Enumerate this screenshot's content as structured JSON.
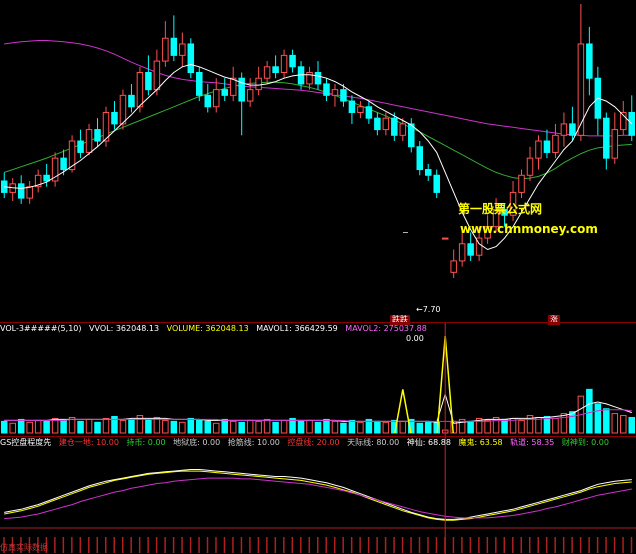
{
  "colors": {
    "up": "#ff5050",
    "down": "#00ffff",
    "ma_white": "#ffffff",
    "ma_magenta": "#cc33cc",
    "ma_green": "#33aa33",
    "text_red": "#ff3333",
    "text_green": "#33cc33",
    "text_yellow": "#ffff00",
    "text_cyan": "#00cccc",
    "text_magenta": "#ff66ff",
    "text_white": "#ffffff",
    "separator": "#8b0000"
  },
  "watermark": {
    "cn": "第一股票公式网",
    "en": "www.chnmoney.com"
  },
  "markers": {
    "low_price": "←7.70",
    "dash": "−",
    "badge_a": "跌跌",
    "badge_b": "涨"
  },
  "vol_header": {
    "name": "VOL-3#####(5,10)",
    "vvol": "VVOL: 362048.13",
    "volume": "VOLUME: 362048.13",
    "mavol1": "MAVOL1: 366429.59",
    "mavol2": "MAVOL2: 275037.88",
    "value": "0.00"
  },
  "ind_header": {
    "name": "GS控盘程度先",
    "i1": "建仓一地: 10.00",
    "i2": "持币: 0.00",
    "i3": "地狱底: 0.00",
    "i4": "抢筋线: 10.00",
    "i5": "控盘线: 20.00",
    "i6": "天际线: 80.00",
    "i7": "神仙: 68.88",
    "i8": "魔鬼: 63.58",
    "i9": "轨道: 58.35",
    "i10": "财神到: 0.00"
  },
  "footer_label": "仿真实际数据",
  "chart_data": [
    {
      "type": "candlestick",
      "title": "",
      "ylim": [
        7.0,
        12.5
      ],
      "low_label": 7.7,
      "candles": [
        [
          9.4,
          9.2,
          9.55,
          9.1
        ],
        [
          9.2,
          9.35,
          9.45,
          9.05
        ],
        [
          9.35,
          9.1,
          9.5,
          9.0
        ],
        [
          9.1,
          9.3,
          9.4,
          9.0
        ],
        [
          9.3,
          9.5,
          9.6,
          9.2
        ],
        [
          9.5,
          9.4,
          9.7,
          9.3
        ],
        [
          9.4,
          9.8,
          9.9,
          9.3
        ],
        [
          9.8,
          9.6,
          9.95,
          9.5
        ],
        [
          9.6,
          10.1,
          10.2,
          9.55
        ],
        [
          10.1,
          9.9,
          10.3,
          9.8
        ],
        [
          9.9,
          10.3,
          10.4,
          9.85
        ],
        [
          10.3,
          10.1,
          10.5,
          10.0
        ],
        [
          10.1,
          10.6,
          10.7,
          10.0
        ],
        [
          10.6,
          10.4,
          10.8,
          10.3
        ],
        [
          10.4,
          10.9,
          11.0,
          10.3
        ],
        [
          10.9,
          10.7,
          11.1,
          10.6
        ],
        [
          10.7,
          11.3,
          11.4,
          10.6
        ],
        [
          11.3,
          11.0,
          11.6,
          10.9
        ],
        [
          11.0,
          11.5,
          11.7,
          10.9
        ],
        [
          11.5,
          11.9,
          12.2,
          11.4
        ],
        [
          11.9,
          11.6,
          12.3,
          11.5
        ],
        [
          11.6,
          11.8,
          12.0,
          11.4
        ],
        [
          11.8,
          11.3,
          11.9,
          11.2
        ],
        [
          11.3,
          10.9,
          11.4,
          10.8
        ],
        [
          10.9,
          10.7,
          11.1,
          10.6
        ],
        [
          10.7,
          11.0,
          11.2,
          10.6
        ],
        [
          11.0,
          10.9,
          11.2,
          10.8
        ],
        [
          10.9,
          11.2,
          11.4,
          10.8
        ],
        [
          11.2,
          10.8,
          11.3,
          10.2
        ],
        [
          10.8,
          11.0,
          11.2,
          10.7
        ],
        [
          11.0,
          11.2,
          11.4,
          10.9
        ],
        [
          11.2,
          11.4,
          11.5,
          11.1
        ],
        [
          11.4,
          11.3,
          11.6,
          11.2
        ],
        [
          11.3,
          11.6,
          11.7,
          11.2
        ],
        [
          11.6,
          11.4,
          11.7,
          11.3
        ],
        [
          11.4,
          11.1,
          11.5,
          11.0
        ],
        [
          11.1,
          11.3,
          11.4,
          11.0
        ],
        [
          11.3,
          11.1,
          11.5,
          11.0
        ],
        [
          11.1,
          10.9,
          11.2,
          10.8
        ],
        [
          10.9,
          11.0,
          11.1,
          10.7
        ],
        [
          11.0,
          10.8,
          11.1,
          10.7
        ],
        [
          10.8,
          10.6,
          10.9,
          10.4
        ],
        [
          10.6,
          10.7,
          10.8,
          10.5
        ],
        [
          10.7,
          10.5,
          10.8,
          10.4
        ],
        [
          10.5,
          10.3,
          10.6,
          10.2
        ],
        [
          10.3,
          10.5,
          10.6,
          10.2
        ],
        [
          10.5,
          10.2,
          10.6,
          10.1
        ],
        [
          10.2,
          10.4,
          10.5,
          10.1
        ],
        [
          10.4,
          10.0,
          10.5,
          9.9
        ],
        [
          10.0,
          9.6,
          10.1,
          9.5
        ],
        [
          9.6,
          9.5,
          9.7,
          9.4
        ],
        [
          9.5,
          9.2,
          9.6,
          9.1
        ],
        [
          8.4,
          8.4,
          8.4,
          8.4
        ],
        [
          7.8,
          8.0,
          8.2,
          7.7
        ],
        [
          8.0,
          8.3,
          8.6,
          7.9
        ],
        [
          8.3,
          8.1,
          8.5,
          8.0
        ],
        [
          8.1,
          8.4,
          8.6,
          8.0
        ],
        [
          8.4,
          8.6,
          8.8,
          8.3
        ],
        [
          8.6,
          8.9,
          9.1,
          8.5
        ],
        [
          8.9,
          8.8,
          9.0,
          8.6
        ],
        [
          8.8,
          9.2,
          9.4,
          8.7
        ],
        [
          9.2,
          9.5,
          9.6,
          9.1
        ],
        [
          9.5,
          9.8,
          10.0,
          9.4
        ],
        [
          9.8,
          10.1,
          10.2,
          9.6
        ],
        [
          10.1,
          9.9,
          10.3,
          9.8
        ],
        [
          9.9,
          10.2,
          10.4,
          9.8
        ],
        [
          10.2,
          10.4,
          10.6,
          10.0
        ],
        [
          10.4,
          10.2,
          10.7,
          10.1
        ],
        [
          10.2,
          11.8,
          12.5,
          10.1
        ],
        [
          11.8,
          11.2,
          12.1,
          10.9
        ],
        [
          11.2,
          10.5,
          11.4,
          10.2
        ],
        [
          10.5,
          9.8,
          10.6,
          9.6
        ],
        [
          9.8,
          10.3,
          10.6,
          9.7
        ],
        [
          10.3,
          10.6,
          10.8,
          10.2
        ],
        [
          10.6,
          10.2,
          10.9,
          10.1
        ]
      ],
      "ma_white": [
        9.3,
        9.28,
        9.27,
        9.29,
        9.33,
        9.38,
        9.47,
        9.56,
        9.66,
        9.76,
        9.88,
        10.0,
        10.14,
        10.28,
        10.42,
        10.56,
        10.72,
        10.86,
        11.0,
        11.16,
        11.3,
        11.4,
        11.44,
        11.4,
        11.34,
        11.28,
        11.22,
        11.18,
        11.12,
        11.08,
        11.08,
        11.1,
        11.14,
        11.2,
        11.24,
        11.26,
        11.26,
        11.24,
        11.2,
        11.14,
        11.06,
        10.96,
        10.88,
        10.8,
        10.7,
        10.62,
        10.54,
        10.46,
        10.38,
        10.26,
        10.1,
        9.9,
        9.55,
        9.2,
        8.85,
        8.55,
        8.3,
        8.2,
        8.25,
        8.4,
        8.6,
        8.85,
        9.1,
        9.35,
        9.55,
        9.75,
        9.95,
        10.1,
        10.4,
        10.7,
        10.85,
        10.8,
        10.7,
        10.55,
        10.4
      ],
      "ma_magenta": [
        11.8,
        11.82,
        11.84,
        11.85,
        11.86,
        11.86,
        11.85,
        11.84,
        11.82,
        11.8,
        11.77,
        11.73,
        11.68,
        11.62,
        11.55,
        11.48,
        11.42,
        11.36,
        11.3,
        11.25,
        11.21,
        11.18,
        11.16,
        11.14,
        11.13,
        11.12,
        11.1,
        11.08,
        11.06,
        11.05,
        11.04,
        11.03,
        11.02,
        11.01,
        11.0,
        10.99,
        10.97,
        10.95,
        10.93,
        10.91,
        10.89,
        10.87,
        10.85,
        10.82,
        10.79,
        10.76,
        10.73,
        10.7,
        10.67,
        10.64,
        10.61,
        10.58,
        10.55,
        10.52,
        10.49,
        10.46,
        10.43,
        10.4,
        10.38,
        10.36,
        10.34,
        10.32,
        10.3,
        10.28,
        10.26,
        10.24,
        10.22,
        10.21,
        10.2,
        10.19,
        10.19,
        10.19,
        10.19,
        10.2,
        10.2
      ],
      "ma_green": [
        9.55,
        9.6,
        9.65,
        9.7,
        9.75,
        9.8,
        9.86,
        9.92,
        9.98,
        10.04,
        10.1,
        10.16,
        10.22,
        10.28,
        10.34,
        10.4,
        10.46,
        10.52,
        10.58,
        10.64,
        10.7,
        10.76,
        10.82,
        10.88,
        10.93,
        10.98,
        11.02,
        11.06,
        11.09,
        11.11,
        11.12,
        11.13,
        11.13,
        11.12,
        11.1,
        11.07,
        11.04,
        11.0,
        10.95,
        10.9,
        10.84,
        10.78,
        10.72,
        10.66,
        10.6,
        10.54,
        10.47,
        10.4,
        10.33,
        10.26,
        10.18,
        10.1,
        10.02,
        9.94,
        9.86,
        9.78,
        9.7,
        9.62,
        9.55,
        9.5,
        9.46,
        9.44,
        9.45,
        9.48,
        9.54,
        9.62,
        9.72,
        9.8,
        9.88,
        9.94,
        9.98,
        10.0,
        10.02,
        10.03,
        10.04
      ]
    },
    {
      "type": "bar",
      "title": "VOL-3#####(5,10)",
      "ylim": [
        0,
        1
      ],
      "values": [
        0.12,
        0.1,
        0.14,
        0.11,
        0.13,
        0.12,
        0.15,
        0.13,
        0.16,
        0.12,
        0.14,
        0.11,
        0.15,
        0.17,
        0.13,
        0.14,
        0.18,
        0.14,
        0.16,
        0.13,
        0.12,
        0.11,
        0.15,
        0.13,
        0.12,
        0.1,
        0.14,
        0.12,
        0.11,
        0.13,
        0.12,
        0.14,
        0.11,
        0.13,
        0.15,
        0.12,
        0.13,
        0.11,
        0.14,
        0.12,
        0.1,
        0.13,
        0.11,
        0.14,
        0.12,
        0.11,
        0.13,
        0.12,
        0.14,
        0.1,
        0.12,
        0.11,
        0.03,
        0.12,
        0.14,
        0.12,
        0.15,
        0.13,
        0.16,
        0.14,
        0.15,
        0.13,
        0.18,
        0.16,
        0.17,
        0.15,
        0.2,
        0.22,
        0.38,
        0.45,
        0.3,
        0.25,
        0.2,
        0.18,
        0.16
      ],
      "mavol1": [
        0.13,
        0.13,
        0.13,
        0.13,
        0.13,
        0.13,
        0.14,
        0.14,
        0.14,
        0.14,
        0.14,
        0.14,
        0.14,
        0.14,
        0.14,
        0.15,
        0.15,
        0.15,
        0.15,
        0.15,
        0.14,
        0.14,
        0.14,
        0.14,
        0.13,
        0.13,
        0.13,
        0.13,
        0.13,
        0.13,
        0.13,
        0.13,
        0.13,
        0.13,
        0.13,
        0.13,
        0.13,
        0.13,
        0.13,
        0.13,
        0.12,
        0.12,
        0.12,
        0.12,
        0.12,
        0.12,
        0.12,
        0.12,
        0.12,
        0.12,
        0.12,
        0.11,
        0.4,
        0.1,
        0.11,
        0.12,
        0.13,
        0.14,
        0.14,
        0.14,
        0.15,
        0.15,
        0.15,
        0.16,
        0.16,
        0.17,
        0.18,
        0.2,
        0.25,
        0.3,
        0.32,
        0.3,
        0.27,
        0.24,
        0.21
      ],
      "mavol2": [
        0.13,
        0.13,
        0.13,
        0.13,
        0.13,
        0.13,
        0.13,
        0.13,
        0.14,
        0.14,
        0.14,
        0.14,
        0.14,
        0.14,
        0.14,
        0.14,
        0.14,
        0.14,
        0.14,
        0.14,
        0.14,
        0.14,
        0.14,
        0.14,
        0.14,
        0.14,
        0.13,
        0.13,
        0.13,
        0.13,
        0.13,
        0.13,
        0.13,
        0.13,
        0.13,
        0.13,
        0.13,
        0.13,
        0.13,
        0.13,
        0.13,
        0.12,
        0.12,
        0.12,
        0.12,
        0.12,
        0.12,
        0.12,
        0.12,
        0.12,
        0.12,
        0.12,
        0.12,
        0.12,
        0.12,
        0.12,
        0.12,
        0.12,
        0.13,
        0.13,
        0.13,
        0.14,
        0.14,
        0.14,
        0.15,
        0.15,
        0.16,
        0.17,
        0.19,
        0.21,
        0.23,
        0.24,
        0.24,
        0.24,
        0.23
      ],
      "spike_yellow": [
        [
          47,
          0.45
        ],
        [
          52,
          1.0
        ]
      ]
    },
    {
      "type": "line",
      "title": "GS控盘程度先",
      "ylim": [
        0,
        100
      ],
      "series": [
        {
          "name": "神仙",
          "values": [
            20,
            22,
            24,
            27,
            30,
            34,
            38,
            42,
            46,
            50,
            54,
            57,
            60,
            62,
            64,
            66,
            68,
            70,
            71,
            72,
            73,
            74,
            75,
            75,
            74,
            73,
            72,
            71,
            70,
            69,
            68,
            67,
            66,
            66,
            65,
            64,
            62,
            60,
            58,
            55,
            52,
            48,
            44,
            40,
            36,
            32,
            28,
            24,
            20,
            17,
            14,
            12,
            11,
            11,
            12,
            14,
            16,
            18,
            20,
            22,
            24,
            27,
            30,
            33,
            36,
            39,
            42,
            45,
            48,
            52,
            56,
            58,
            60,
            61,
            62
          ]
        },
        {
          "name": "魔鬼",
          "values": [
            18,
            20,
            22,
            25,
            28,
            32,
            36,
            40,
            44,
            48,
            52,
            55,
            58,
            61,
            63,
            65,
            67,
            69,
            70,
            71,
            72,
            73,
            73,
            73,
            72,
            71,
            70,
            69,
            68,
            67,
            66,
            65,
            64,
            63,
            62,
            61,
            59,
            57,
            55,
            52,
            49,
            46,
            42,
            38,
            34,
            30,
            26,
            22,
            19,
            16,
            13,
            11,
            10,
            10,
            11,
            12,
            14,
            16,
            18,
            20,
            22,
            25,
            28,
            31,
            34,
            37,
            40,
            43,
            46,
            50,
            53,
            55,
            57,
            58,
            59
          ]
        },
        {
          "name": "轨道",
          "values": [
            12,
            13,
            14,
            16,
            18,
            21,
            24,
            27,
            30,
            34,
            37,
            40,
            43,
            46,
            48,
            51,
            53,
            55,
            57,
            58,
            60,
            61,
            62,
            63,
            64,
            64,
            64,
            64,
            63,
            63,
            62,
            61,
            60,
            59,
            58,
            57,
            56,
            54,
            52,
            50,
            48,
            45,
            42,
            39,
            36,
            33,
            30,
            27,
            24,
            21,
            19,
            17,
            15,
            14,
            13,
            13,
            13,
            13,
            14,
            15,
            16,
            18,
            20,
            22,
            25,
            27,
            30,
            33,
            36,
            39,
            42,
            44,
            46,
            48,
            50
          ]
        }
      ]
    }
  ]
}
